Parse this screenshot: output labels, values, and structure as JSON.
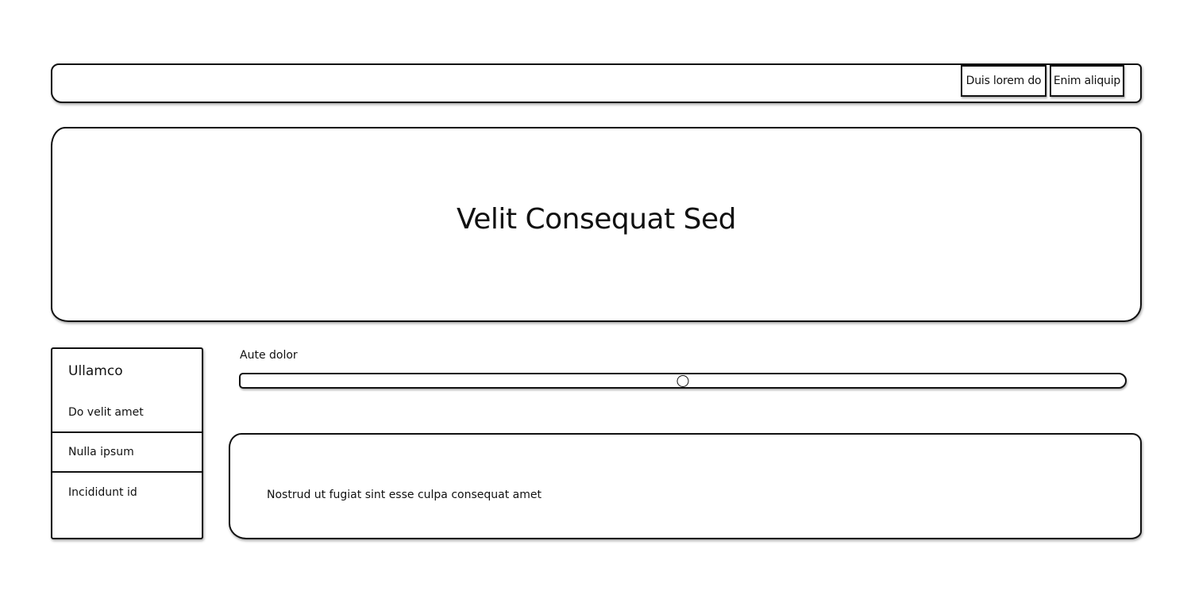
{
  "nav": {
    "buttons": [
      {
        "label": "Duis lorem do"
      },
      {
        "label": "Enim aliquip"
      }
    ]
  },
  "hero": {
    "title": "Velit Consequat Sed"
  },
  "sidebar": {
    "heading": "Ullamco",
    "items": [
      {
        "label": "Do velit amet"
      },
      {
        "label": "Nulla ipsum"
      },
      {
        "label": "Incididunt id"
      }
    ]
  },
  "slider": {
    "label": "Aute dolor",
    "value_fraction": 0.5
  },
  "content": {
    "text": "Nostrud ut fugiat sint esse culpa consequat amet"
  }
}
